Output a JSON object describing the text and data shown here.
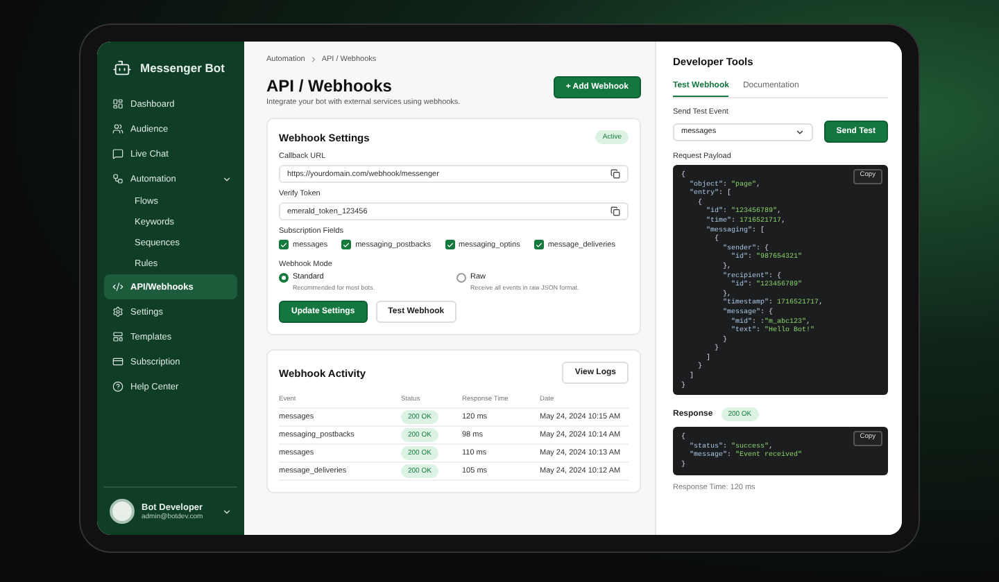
{
  "sidebar": {
    "brand": "Messenger Bot",
    "items": [
      {
        "label": "Dashboard",
        "selected": false
      },
      {
        "label": "Audience",
        "selected": false
      },
      {
        "label": "Live Chat",
        "selected": false
      },
      {
        "label": "Automation",
        "selected": false,
        "expanded": true,
        "children": [
          {
            "label": "Flows",
            "selected": false
          },
          {
            "label": "Keywords",
            "selected": false
          },
          {
            "label": "Sequences",
            "selected": false
          },
          {
            "label": "Rules",
            "selected": false
          }
        ]
      },
      {
        "label": "API/Webhooks",
        "selected": true
      },
      {
        "label": "Settings",
        "selected": false
      },
      {
        "label": "Templates",
        "selected": false
      },
      {
        "label": "Subscription",
        "selected": false
      },
      {
        "label": "Help Center",
        "selected": false
      }
    ],
    "user": {
      "name": "Bot Developer",
      "email": "admin@botdev.com"
    }
  },
  "main": {
    "breadcrumb": [
      "Automation",
      "API / Webhooks"
    ],
    "title": "API / Webhooks",
    "subtitle": "Integrate your bot with external services using webhooks.",
    "add_button": "+ Add Webhook",
    "settings": {
      "title": "Webhook Settings",
      "badge": "Active",
      "fields": [
        {
          "label": "Callback URL",
          "value": "https://yourdomain.com/webhook/messenger"
        },
        {
          "label": "Verify Token",
          "value": "emerald_token_123456"
        }
      ],
      "subscription_label": "Subscription Fields",
      "checkboxes": [
        {
          "label": "messages",
          "checked": true
        },
        {
          "label": "messaging_postbacks",
          "checked": true
        },
        {
          "label": "messaging_optins",
          "checked": true
        },
        {
          "label": "message_deliveries",
          "checked": true
        }
      ],
      "mode_label": "Webhook Mode",
      "radios": [
        {
          "label": "Standard",
          "hint": "Recommended for most bots.",
          "selected": true
        },
        {
          "label": "Raw",
          "hint": "Receive all events in raw JSON format.",
          "selected": false
        }
      ],
      "buttons": [
        {
          "label": "Update Settings",
          "kind": "primary"
        },
        {
          "label": "Test Webhook",
          "kind": "secondary"
        }
      ]
    },
    "activity": {
      "title": "Webhook Activity",
      "button": "View Logs",
      "columns": [
        "Event",
        "Status",
        "Response Time",
        "Date"
      ],
      "rows": [
        {
          "event": "messages",
          "status": "200 OK",
          "time": "120 ms",
          "date": "May 24, 2024 10:15 AM"
        },
        {
          "event": "messaging_postbacks",
          "status": "200 OK",
          "time": "98 ms",
          "date": "May 24, 2024 10:14 AM"
        },
        {
          "event": "messages",
          "status": "200 OK",
          "time": "110 ms",
          "date": "May 24, 2024 10:13 AM"
        },
        {
          "event": "message_deliveries",
          "status": "200 OK",
          "time": "105 ms",
          "date": "May 24, 2024 10:12 AM"
        }
      ]
    }
  },
  "tools": {
    "title": "Developer Tools",
    "tabs": [
      {
        "label": "Test Webhook",
        "selected": true
      },
      {
        "label": "Documentation",
        "selected": false
      }
    ],
    "event_label": "Send Test Event",
    "event_value": "messages",
    "send_button": "Send Test",
    "payload_label": "Request Payload",
    "payload_copy": "Copy",
    "payload": [
      "{",
      "  \"object\": \"page\",",
      "  \"entry\": [",
      "    {",
      "      \"id\": \"123456789\",",
      "      \"time\": 1716521717,",
      "      \"messaging\": [",
      "        {",
      "          \"sender\": {",
      "            \"id\": \"987654321\"",
      "          },",
      "          \"recipient\": {",
      "            \"id\": \"123456789\"",
      "          },",
      "          \"timestamp\": 1716521717,",
      "          \"message\": {",
      "            \"mid\": :\"m_abc123\",",
      "            \"text\": \"Hello Bot!\"",
      "          }",
      "        }",
      "      ]",
      "    }",
      "  ]",
      "}"
    ],
    "response_label": "Response",
    "response_badge": "200 OK",
    "response_copy": "Copy",
    "response": [
      "{",
      "  \"status\": \"success\",",
      "  \"message\": \"Event received\"",
      "}"
    ],
    "response_time": "Response Time: 120 ms"
  }
}
